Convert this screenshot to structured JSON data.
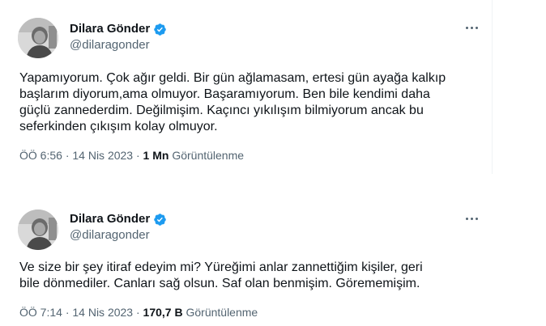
{
  "tweets": [
    {
      "author": {
        "name": "Dilara Gönder",
        "handle": "@dilaragonder",
        "verified_icon": "verified-badge-icon",
        "verified_color": "#1d9bf0"
      },
      "text_lines": [
        "Yapamıyorum. Çok ağır geldi. Bir gün ağlamasam, ertesi gün ayağa kalkıp",
        "başlarım diyorum,ama olmuyor. Başaramıyorum. Ben bile kendimi daha",
        "güçlü zannederdim. Değilmişim. Kaçıncı yıkılışım bilmiyorum ancak bu",
        "seferkinden çıkışım kolay olmuyor."
      ],
      "time": "ÖÖ 6:56",
      "date": "14 Nis 2023",
      "views_count": "1 Mn",
      "views_label": "Görüntülenme"
    },
    {
      "author": {
        "name": "Dilara Gönder",
        "handle": "@dilaragonder",
        "verified_icon": "verified-badge-icon",
        "verified_color": "#1d9bf0"
      },
      "text_lines": [
        "Ve size bir şey itiraf edeyim mi? Yüreğimi anlar zannettiğim kişiler, geri",
        "bile dönmediler. Canları sağ olsun. Saf olan benmişim. Görememişim."
      ],
      "time": "ÖÖ 7:14",
      "date": "14 Nis 2023",
      "views_count": "170,7 B",
      "views_label": "Görüntülenme"
    }
  ],
  "separator": "·",
  "colors": {
    "text": "#0f1419",
    "secondary": "#536471",
    "accent": "#1d9bf0"
  }
}
